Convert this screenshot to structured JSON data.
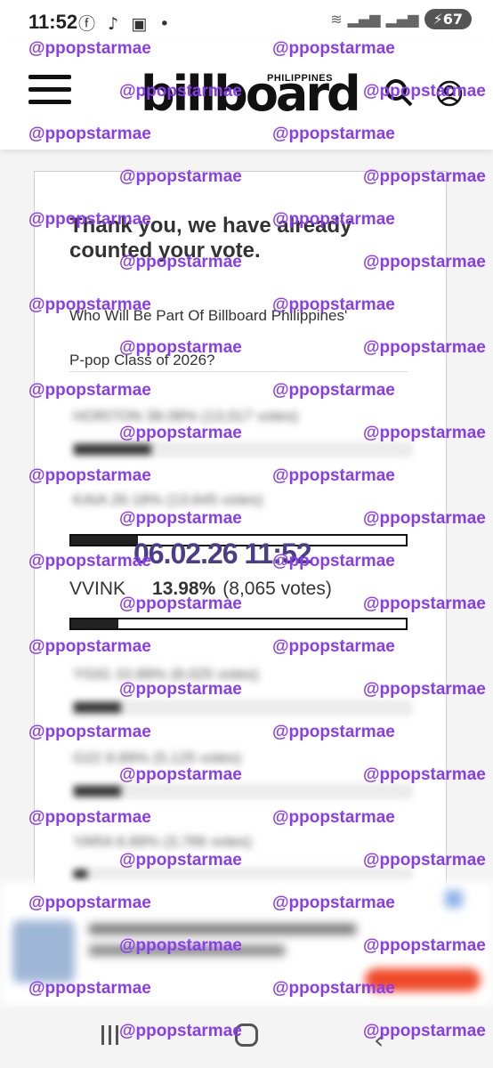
{
  "status_bar": {
    "time": "11:52",
    "left_icons": "ⓕ ♪ ▣ •",
    "battery": "67"
  },
  "header": {
    "brand": "billboard",
    "brand_region": "PHILIPPINES"
  },
  "poll": {
    "thank_you": "Thank you, we have already counted your vote.",
    "question_line1": "Who Will Be Part Of Billboard Philippines'",
    "question_line2": "P-pop Class of 2026?"
  },
  "blurred_results": [
    {
      "text": "HORI7ON  38.08%  (13,017 votes)",
      "fraction": 0.23
    },
    {
      "text": "KAIA  26.18%  (13,645 votes)",
      "fraction": 0.2
    },
    {
      "text": "YGIG  10.89%  (8,025 votes)",
      "fraction": 0.14
    },
    {
      "text": "G22  8.89%  (5,125 votes)",
      "fraction": 0.14
    },
    {
      "text": "YARA  6.89%  (3,766 votes)",
      "fraction": 0.04
    }
  ],
  "visible_result": {
    "name": "VVINK",
    "percent": "13.98%",
    "votes": "(8,065 votes)",
    "fraction": 0.1398
  },
  "bar_above": {
    "fraction": 0.2
  },
  "timestamp": "06.02.26 11:52",
  "watermark": "@ppopstarmae",
  "colors": {
    "watermark": "#8a3df0",
    "stamp": "#4b3d86"
  }
}
